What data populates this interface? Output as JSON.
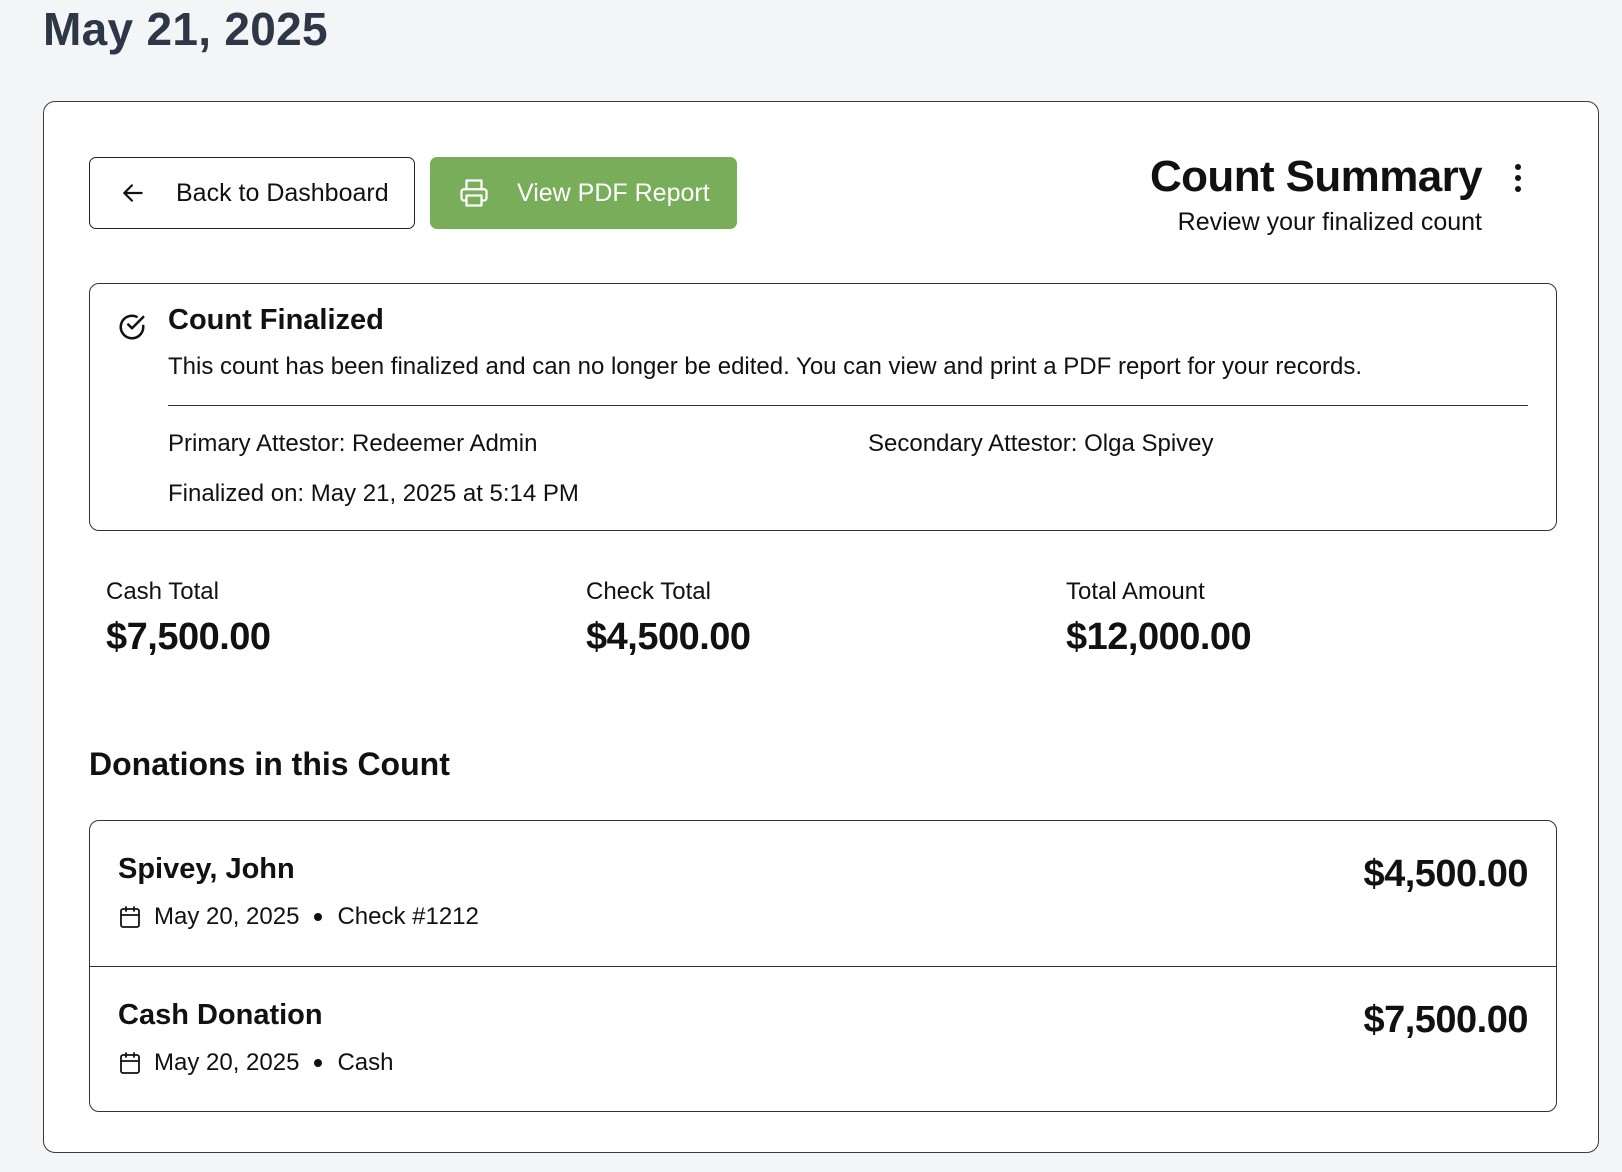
{
  "page": {
    "date_heading": "May 21, 2025"
  },
  "toolbar": {
    "back_label": "Back to Dashboard",
    "pdf_label": "View PDF Report",
    "pdf_button_color": "#78ad59"
  },
  "summary": {
    "title": "Count Summary",
    "subtitle": "Review your finalized count"
  },
  "finalized": {
    "title": "Count Finalized",
    "message": "This count has been finalized and can no longer be edited. You can view and print a PDF report for your records.",
    "primary_attestor": "Primary Attestor: Redeemer Admin",
    "secondary_attestor": "Secondary Attestor: Olga Spivey",
    "finalized_on": "Finalized on: May 21, 2025 at 5:14 PM"
  },
  "totals": [
    {
      "label": "Cash Total",
      "value": "$7,500.00"
    },
    {
      "label": "Check Total",
      "value": "$4,500.00"
    },
    {
      "label": "Total Amount",
      "value": "$12,000.00"
    }
  ],
  "donations_section": {
    "title": "Donations in this Count",
    "items": [
      {
        "name": "Spivey, John",
        "date": "May 20, 2025",
        "method": "Check #1212",
        "amount": "$4,500.00"
      },
      {
        "name": "Cash Donation",
        "date": "May 20, 2025",
        "method": "Cash",
        "amount": "$7,500.00"
      }
    ]
  }
}
